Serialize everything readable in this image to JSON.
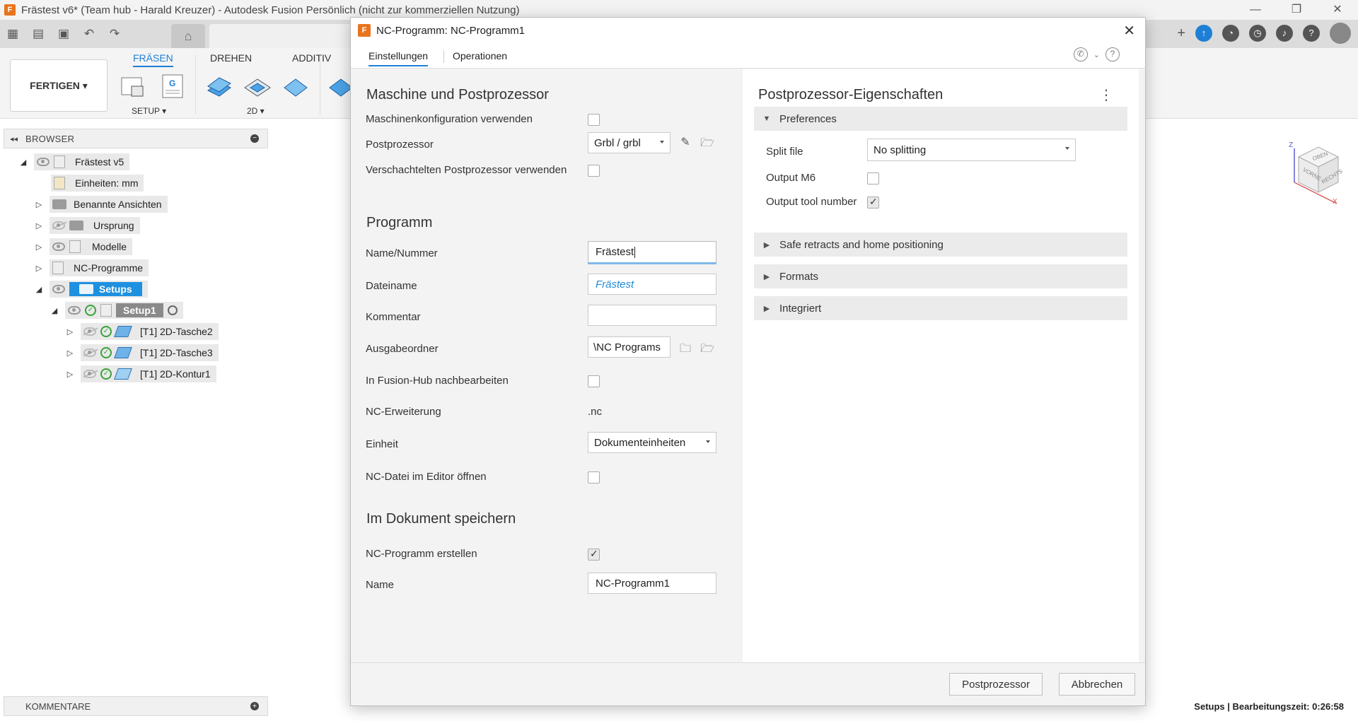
{
  "window": {
    "title": "Frästest v6* (Team hub - Harald Kreuzer) - Autodesk Fusion Persönlich (nicht zur kommerziellen Nutzung)",
    "app_icon": "F"
  },
  "ribbon": {
    "workspace": "FERTIGEN ▾",
    "tabs": [
      "FRÄSEN",
      "DREHEN",
      "ADDITIV"
    ],
    "groups": [
      "SETUP ▾",
      "2D ▾"
    ]
  },
  "browser": {
    "header": "BROWSER",
    "items": [
      {
        "label": "Frästest v5"
      },
      {
        "label": "Einheiten: mm"
      },
      {
        "label": "Benannte Ansichten"
      },
      {
        "label": "Ursprung"
      },
      {
        "label": "Modelle"
      },
      {
        "label": "NC-Programme"
      },
      {
        "label": "Setups"
      },
      {
        "label": "Setup1"
      },
      {
        "label": "[T1] 2D-Tasche2"
      },
      {
        "label": "[T1] 2D-Tasche3"
      },
      {
        "label": "[T1] 2D-Kontur1"
      }
    ],
    "comments_header": "KOMMENTARE"
  },
  "status": "Setups | Bearbeitungszeit: 0:26:58",
  "viewcube": {
    "top": "OBEN",
    "front": "VORNE",
    "right": "RECHTS",
    "z": "Z",
    "x": "X"
  },
  "dialog": {
    "title": "NC-Programm: NC-Programm1",
    "tabs": [
      "Einstellungen",
      "Operationen"
    ],
    "left": {
      "section1": "Maschine und Postprozessor",
      "machine_config_label": "Maschinenkonfiguration verwenden",
      "post_label": "Postprozessor",
      "post_value": "Grbl / grbl",
      "nested_post_label": "Verschachtelten Postprozessor verwenden",
      "section2": "Programm",
      "name_label": "Name/Nummer",
      "name_value": "Frästest",
      "filename_label": "Dateiname",
      "filename_value": "Frästest",
      "comment_label": "Kommentar",
      "comment_value": "",
      "output_label": "Ausgabeordner",
      "output_value": "\\NC Programs",
      "hub_label": "In Fusion-Hub nachbearbeiten",
      "ext_label": "NC-Erweiterung",
      "ext_value": ".nc",
      "unit_label": "Einheit",
      "unit_value": "Dokumenteinheiten",
      "editor_label": "NC-Datei im Editor öffnen",
      "section3": "Im Dokument speichern",
      "create_label": "NC-Programm erstellen",
      "create_checked": true,
      "doc_name_label": "Name",
      "doc_name_value": "NC-Programm1"
    },
    "right": {
      "title": "Postprozessor-Eigenschaften",
      "group_preferences": "Preferences",
      "split_label": "Split file",
      "split_value": "No splitting",
      "m6_label": "Output M6",
      "m6_checked": false,
      "tool_label": "Output tool number",
      "tool_checked": true,
      "group_safe": "Safe retracts and home positioning",
      "group_formats": "Formats",
      "group_integrated": "Integriert"
    },
    "footer": {
      "post_button": "Postprozessor",
      "cancel_button": "Abbrechen"
    }
  }
}
